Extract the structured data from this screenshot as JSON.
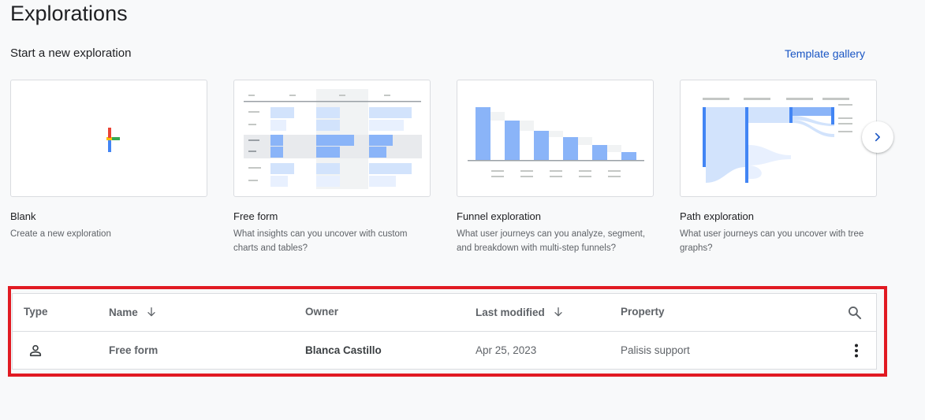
{
  "page": {
    "title": "Explorations",
    "subtitle": "Start a new exploration",
    "template_gallery_label": "Template gallery"
  },
  "templates": [
    {
      "name": "Blank",
      "description": "Create a new exploration",
      "thumbnail_icon": "plus-icon"
    },
    {
      "name": "Free form",
      "description": "What insights can you uncover with custom charts and tables?",
      "thumbnail_icon": "free-form-thumbnail"
    },
    {
      "name": "Funnel exploration",
      "description": "What user journeys can you analyze, segment, and breakdown with multi-step funnels?",
      "thumbnail_icon": "funnel-thumbnail"
    },
    {
      "name": "Path exploration",
      "description": "What user journeys can you uncover with tree graphs?",
      "thumbnail_icon": "path-thumbnail"
    }
  ],
  "table": {
    "columns": [
      "Type",
      "Name",
      "Owner",
      "Last modified",
      "Property"
    ],
    "rows": [
      {
        "type_icon": "person-icon",
        "name": "Free form",
        "owner": "Blanca Castillo",
        "last_modified": "Apr 25, 2023",
        "property": "Palisis support"
      }
    ]
  },
  "colors": {
    "accent_link": "#1a56c4",
    "highlight": "#e11a22",
    "thumbnail_blue": "#8ab4f8",
    "plus_blue": "#4285f4",
    "plus_red": "#ea4335",
    "plus_yellow": "#fbbc04",
    "plus_green": "#34a853"
  }
}
